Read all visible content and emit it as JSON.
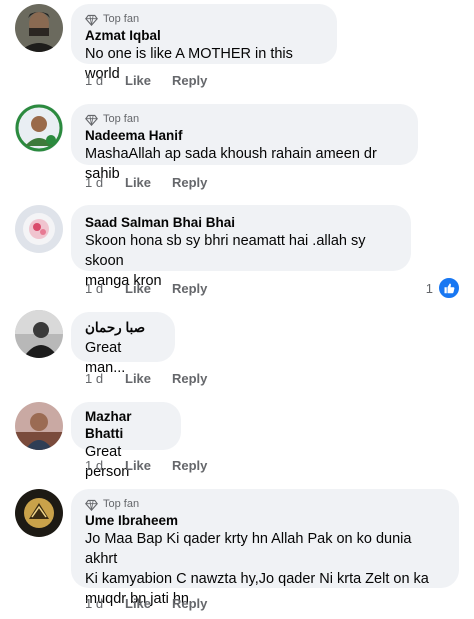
{
  "comments": [
    {
      "badge": "Top fan",
      "name": "Azmat Iqbal",
      "text": [
        "No one is like A MOTHER in this world"
      ],
      "time": "1 d",
      "like": "Like",
      "reply": "Reply"
    },
    {
      "badge": "Top fan",
      "name": "Nadeema Hanif",
      "text": [
        "MashaAllah ap sada khoush rahain ameen dr sahib"
      ],
      "time": "1 d",
      "like": "Like",
      "reply": "Reply"
    },
    {
      "name": "Saad Salman Bhai Bhai",
      "text": [
        "Skoon hona sb sy bhri neamatt hai  .allah sy skoon",
        "manga kron"
      ],
      "time": "1 d",
      "like": "Like",
      "reply": "Reply",
      "reaction_count": "1",
      "reaction_icon": "like-thumb-icon"
    },
    {
      "name": "صبا رحمان",
      "text": [
        "Great man..."
      ],
      "time": "1 d",
      "like": "Like",
      "reply": "Reply"
    },
    {
      "name": "Mazhar Bhatti",
      "text": [
        "Great person"
      ],
      "time": "1 d",
      "like": "Like",
      "reply": "Reply"
    },
    {
      "badge": "Top fan",
      "name": "Ume Ibraheem",
      "text": [
        "Jo Maa Bap Ki qader krty hn Allah Pak on ko dunia akhrt",
        "Ki kamyabion C nawzta hy,Jo qader Ni krta Zelt on ka",
        "muqdr bn jati hn"
      ],
      "time": "1 d",
      "like": "Like",
      "reply": "Reply"
    }
  ],
  "colors": {
    "bubble": "#f0f2f5",
    "meta": "#65676b",
    "accent": "#1877f2"
  }
}
